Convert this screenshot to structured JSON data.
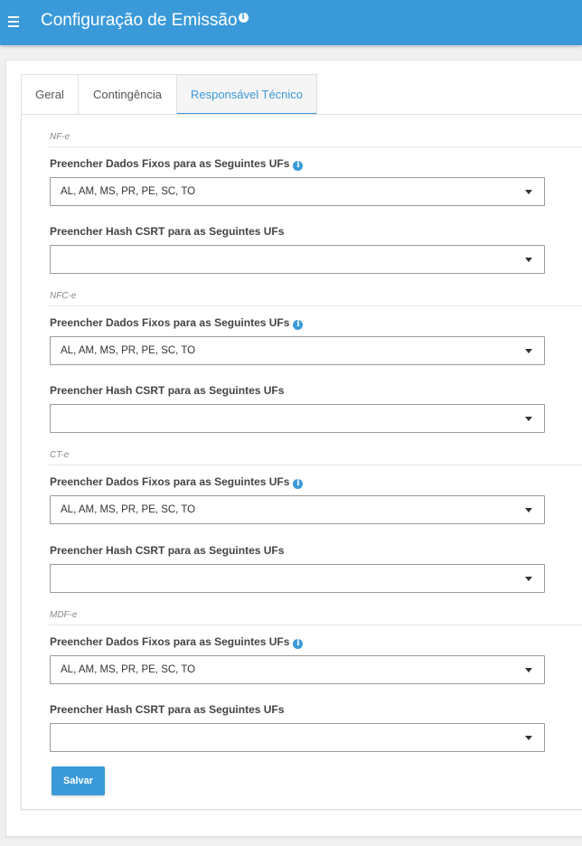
{
  "header": {
    "title": "Configuração de Emissão",
    "info_glyph": "i"
  },
  "tabs": [
    {
      "label": "Geral"
    },
    {
      "label": "Contingência"
    },
    {
      "label": "Responsável Técnico",
      "active": true
    }
  ],
  "sections": [
    {
      "title": "NF-e",
      "fixed_label": "Preencher Dados Fixos para as Seguintes UFs",
      "fixed_value": "AL, AM, MS, PR, PE, SC, TO",
      "hash_label": "Preencher Hash CSRT para as Seguintes UFs",
      "hash_value": ""
    },
    {
      "title": "NFC-e",
      "fixed_label": "Preencher Dados Fixos para as Seguintes UFs",
      "fixed_value": "AL, AM, MS, PR, PE, SC, TO",
      "hash_label": "Preencher Hash CSRT para as Seguintes UFs",
      "hash_value": ""
    },
    {
      "title": "CT-e",
      "fixed_label": "Preencher Dados Fixos para as Seguintes UFs",
      "fixed_value": "AL, AM, MS, PR, PE, SC, TO",
      "hash_label": "Preencher Hash CSRT para as Seguintes UFs",
      "hash_value": ""
    },
    {
      "title": "MDF-e",
      "fixed_label": "Preencher Dados Fixos para as Seguintes UFs",
      "fixed_value": "AL, AM, MS, PR, PE, SC, TO",
      "hash_label": "Preencher Hash CSRT para as Seguintes UFs",
      "hash_value": ""
    }
  ],
  "info_glyph": "i",
  "save_label": "Salvar",
  "colors": {
    "primary": "#3a9ad9",
    "background": "#f0f0f0"
  }
}
